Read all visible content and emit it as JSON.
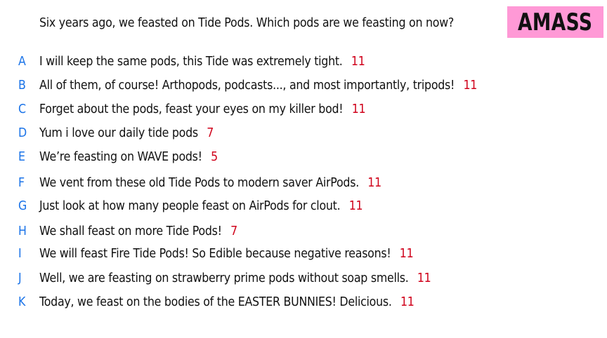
{
  "question": "Six years ago, we feasted on Tide Pods. Which pods are we feasting on now?",
  "logo": "AMASS",
  "colors": {
    "letter": "#1a73e8",
    "score": "#d0021b",
    "logo_bg": "#ff99d6",
    "text": "#111111"
  },
  "answers": [
    {
      "letter": "A",
      "text": "I will keep the same pods, this Tide was extremely tight.",
      "score": "11"
    },
    {
      "letter": "B",
      "text": "All of them, of course!  Arthopods, podcasts..., and most importantly, tripods!",
      "score": "11"
    },
    {
      "letter": "C",
      "text": "Forget about the pods, feast your eyes on my killer bod!",
      "score": "11"
    },
    {
      "letter": "D",
      "text": "Yum i love our daily tide pods",
      "score": "7"
    },
    {
      "letter": "E",
      "text": "We’re feasting on WAVE pods!",
      "score": "5"
    },
    {
      "letter": "F",
      "text": "We vent from these old Tide Pods to modern saver AirPods.",
      "score": "11"
    },
    {
      "letter": "G",
      "text": "Just look at how many people feast on AirPods for clout.",
      "score": "11"
    },
    {
      "letter": "H",
      "text": "We shall feast on more Tide Pods!",
      "score": "7"
    },
    {
      "letter": "I",
      "text": "We will feast Fire Tide Pods! So Edible because negative reasons!",
      "score": "11"
    },
    {
      "letter": "J",
      "text": "Well, we are feasting on strawberry prime pods without soap smells.",
      "score": "11"
    },
    {
      "letter": "K",
      "text": "Today, we feast on the bodies of the EASTER BUNNIES! Delicious.",
      "score": "11"
    }
  ]
}
